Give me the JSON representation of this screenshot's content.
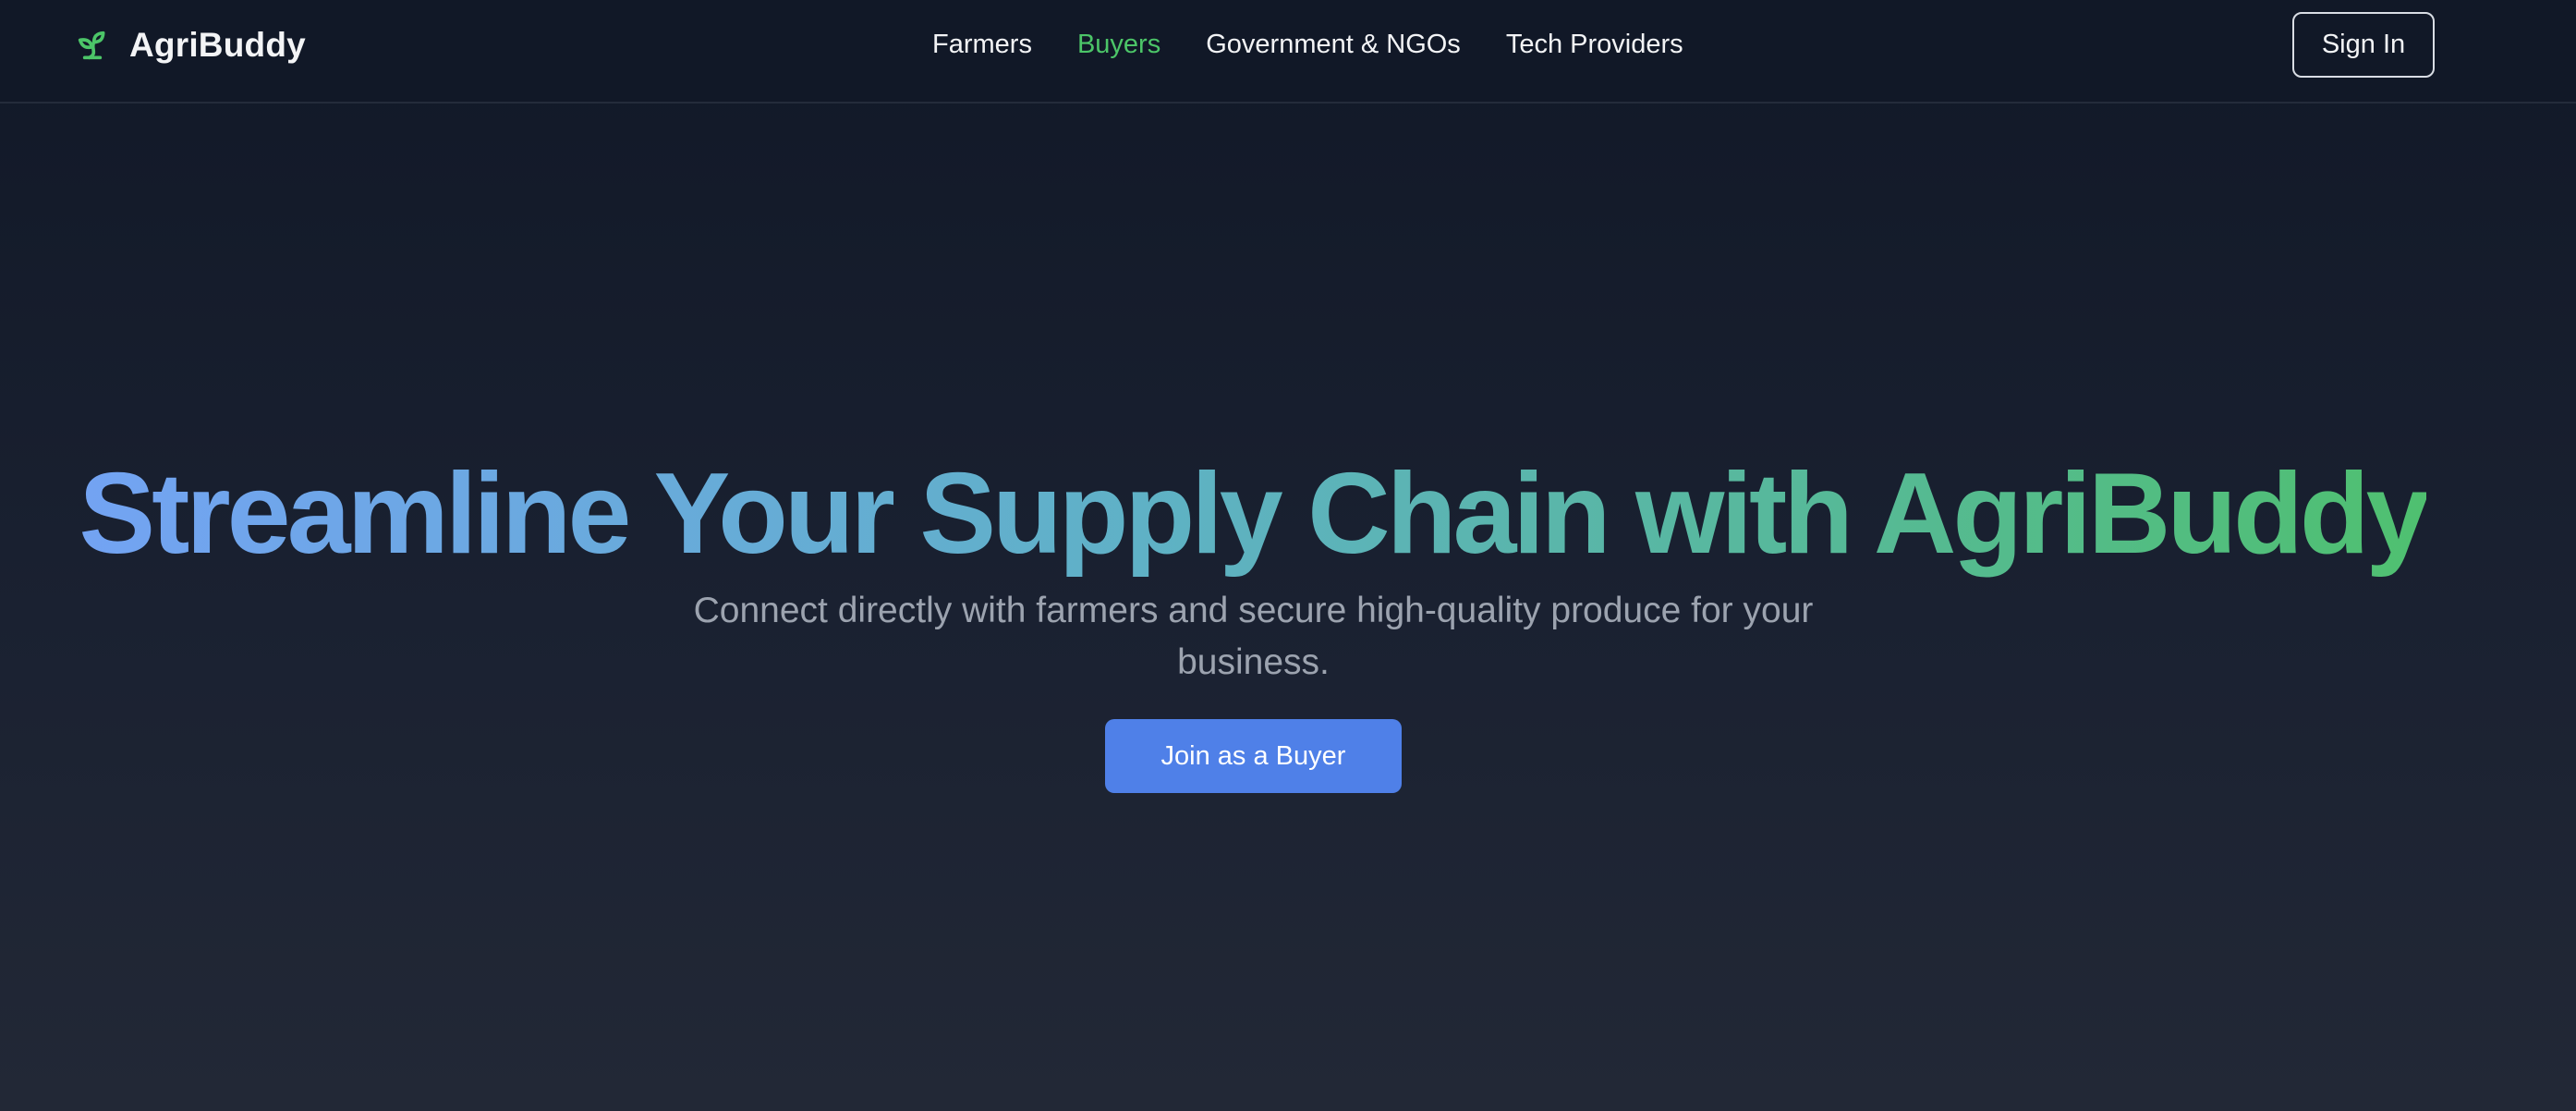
{
  "header": {
    "brand": {
      "name": "AgriBuddy",
      "icon": "sprout-icon",
      "icon_color": "#4cc568"
    },
    "nav": [
      {
        "label": "Farmers",
        "active": false
      },
      {
        "label": "Buyers",
        "active": true
      },
      {
        "label": "Government & NGOs",
        "active": false
      },
      {
        "label": "Tech Providers",
        "active": false
      }
    ],
    "sign_in_label": "Sign In"
  },
  "hero": {
    "title": "Streamline Your Supply Chain with AgriBuddy",
    "title_gradient": [
      "#73a3f3",
      "#5fb1c6",
      "#4fc070"
    ],
    "subtitle": "Connect directly with farmers and secure high-quality produce for your business.",
    "cta_label": "Join as a Buyer"
  },
  "colors": {
    "background_top": "#111827",
    "background_bottom": "#222836",
    "accent_green": "#4cc568",
    "accent_blue": "#4f80e8",
    "muted_text": "#9ca3af"
  }
}
